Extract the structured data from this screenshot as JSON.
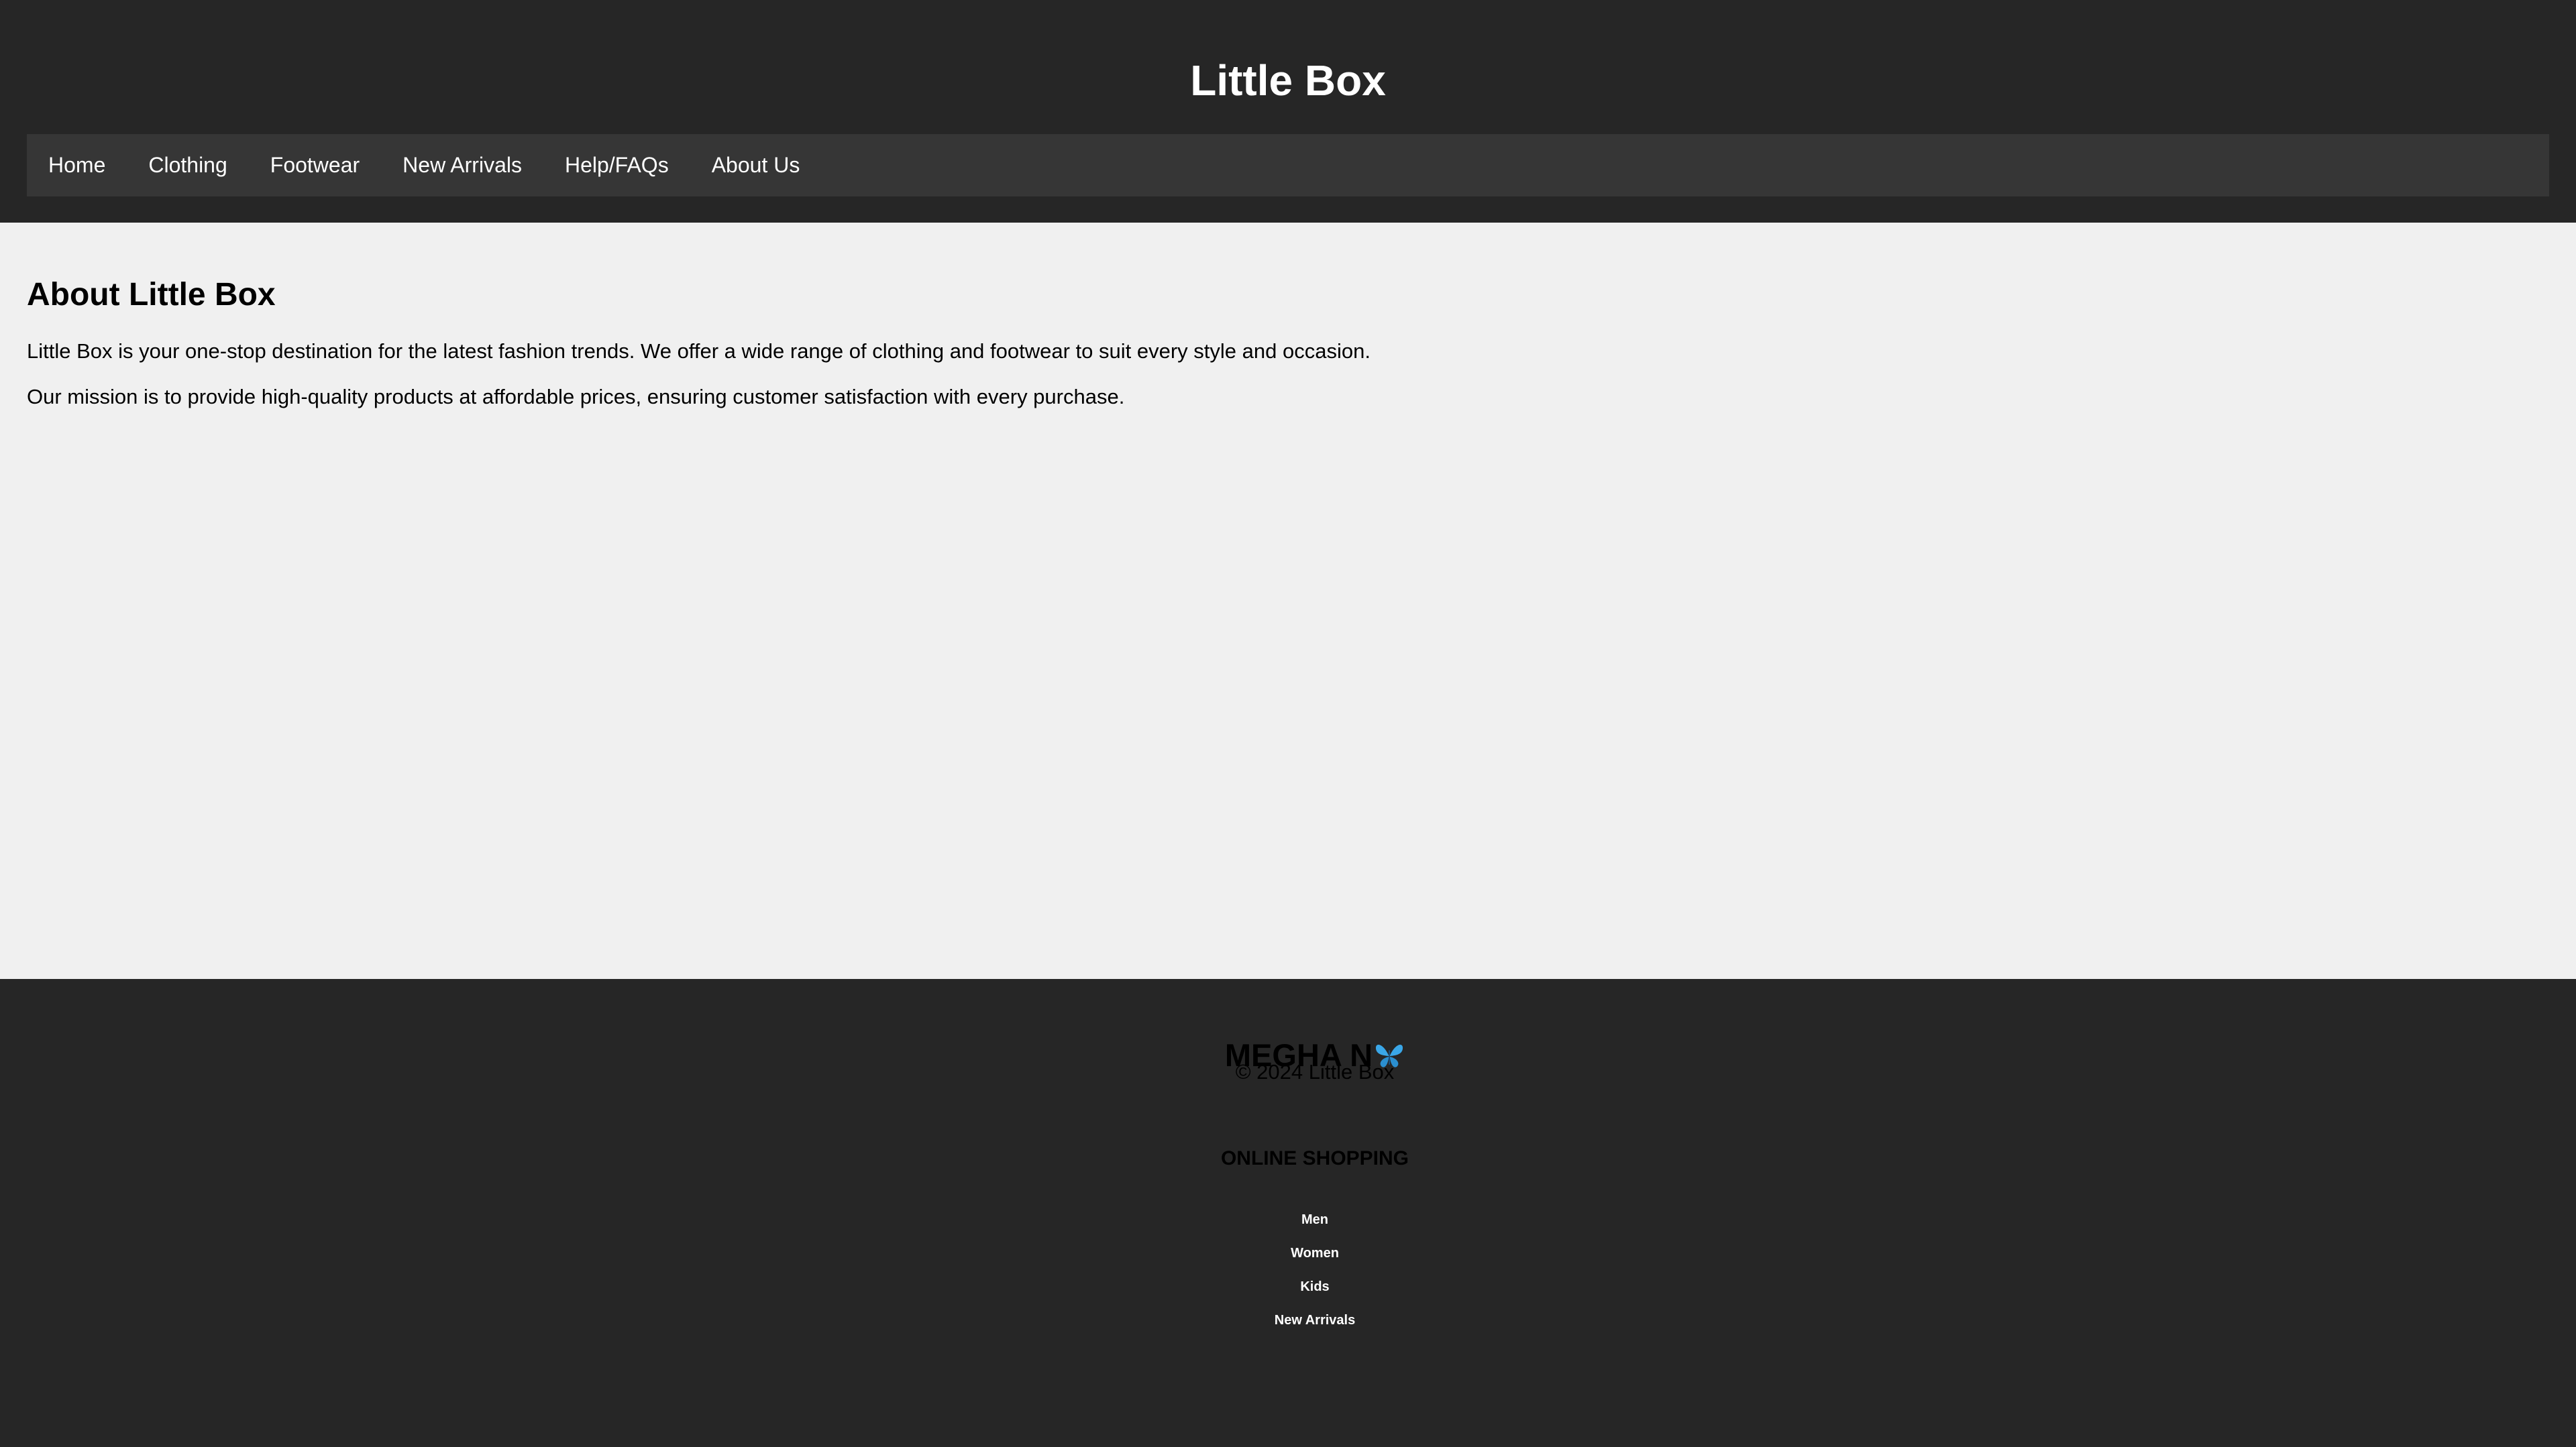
{
  "header": {
    "title": "Little Box"
  },
  "nav": {
    "items": [
      {
        "label": "Home"
      },
      {
        "label": "Clothing"
      },
      {
        "label": "Footwear"
      },
      {
        "label": "New Arrivals"
      },
      {
        "label": "Help/FAQs"
      },
      {
        "label": "About Us"
      }
    ]
  },
  "main": {
    "heading": "About Little Box",
    "paragraphs": [
      "Little Box is your one-stop destination for the latest fashion trends. We offer a wide range of clothing and footwear to suit every style and occasion.",
      "Our mission is to provide high-quality products at affordable prices, ensuring customer satisfaction with every purchase."
    ]
  },
  "footer": {
    "brand": "MEGHA N",
    "brand_icon": "butterfly-icon",
    "section_title": "ONLINE SHOPPING",
    "links": [
      {
        "label": "Men"
      },
      {
        "label": "Women"
      },
      {
        "label": "Kids"
      },
      {
        "label": "New Arrivals"
      }
    ],
    "copyright": "© 2024 Little Box"
  },
  "colors": {
    "header_bg": "#262626",
    "nav_bg": "#363636",
    "page_bg": "#f0f0f0",
    "footer_bg": "#262626",
    "butterfly": "#3aa7e8"
  }
}
